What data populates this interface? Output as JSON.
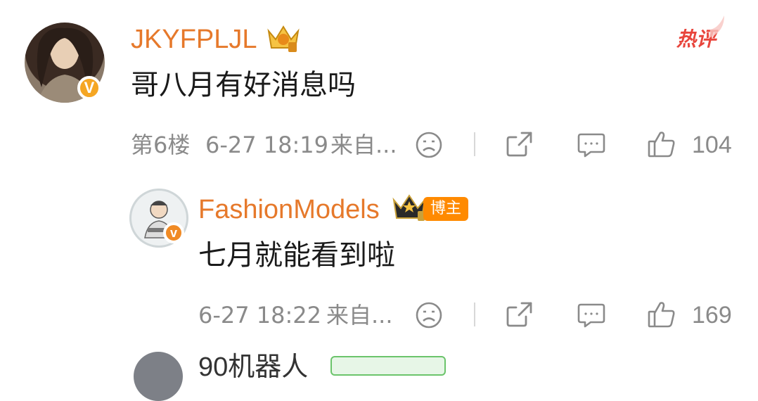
{
  "comments": [
    {
      "username": "JKYFPLJL",
      "text": "哥八月有好消息吗",
      "floor": "第6楼",
      "time": "6-27 18:19",
      "source": "来自...",
      "likes": "104",
      "hot_label": "热评",
      "verified_badge": "V"
    }
  ],
  "replies": [
    {
      "username": "FashionModels",
      "tag": "博主",
      "text": "七月就能看到啦",
      "time": "6-27 18:22",
      "source": "来自...",
      "likes": "169",
      "verified_badge": "v"
    }
  ],
  "partial_next": {
    "username": "90机器人"
  },
  "colors": {
    "username": "#e6792b",
    "hot": "#e8453c",
    "meta": "#8a8a8a",
    "blogger_tag": "#ff8a00",
    "verified": "#f5a623"
  },
  "icons": [
    "emoji-icon",
    "share-icon",
    "comment-icon",
    "like-icon",
    "crown-icon"
  ]
}
